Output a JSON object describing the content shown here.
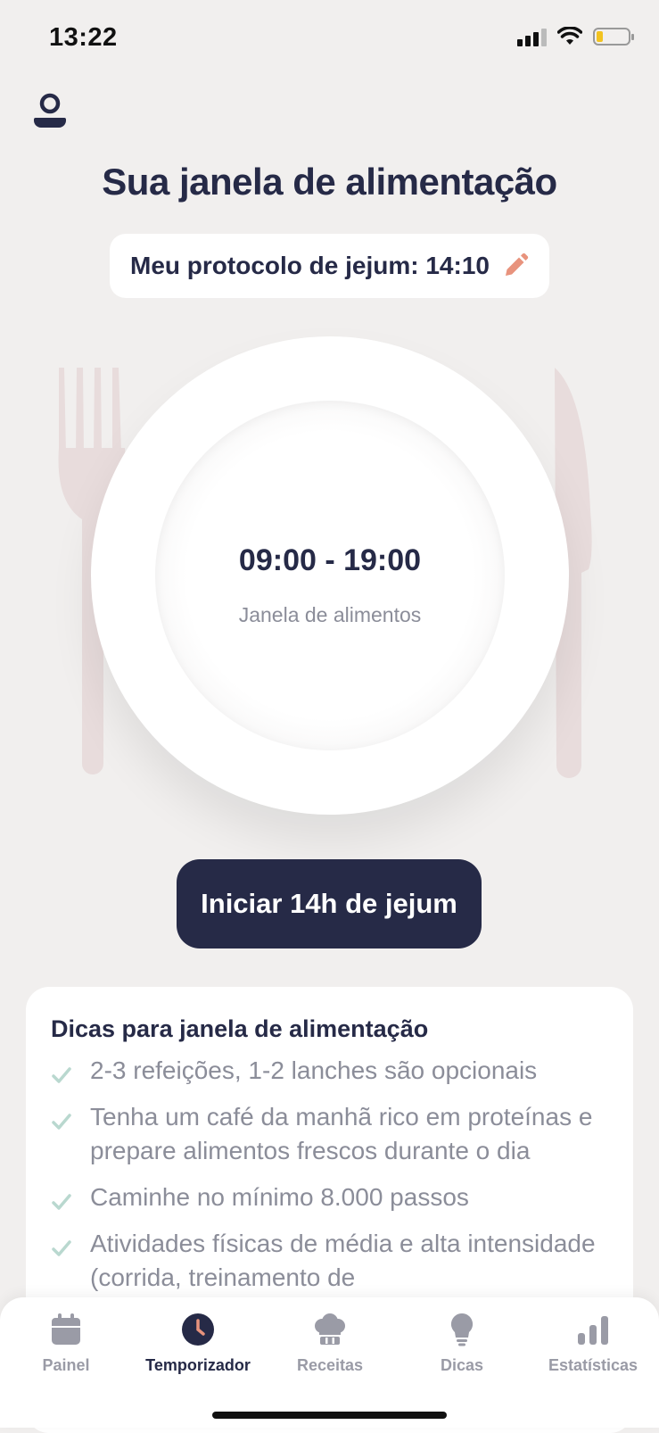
{
  "status": {
    "time": "13:22",
    "signal_icon": "signal-icon",
    "wifi_icon": "wifi-icon",
    "battery_icon": "battery-low-icon",
    "battery_level": 0.2
  },
  "header": {
    "profile_icon": "profile-icon",
    "title": "Sua janela de alimentação"
  },
  "protocol": {
    "label": "Meu protocolo de jejum: 14:10",
    "edit_icon": "pencil-icon"
  },
  "plate": {
    "time_range": "09:00 - 19:00",
    "label": "Janela de alimentos"
  },
  "start_button": {
    "label": "Iniciar 14h de jejum"
  },
  "tips": {
    "title": "Dicas para janela de alimentação",
    "items": [
      "2-3 refeições, 1-2 lanches são opcionais",
      "Tenha um café da manhã rico em proteínas e prepare alimentos frescos durante o dia",
      "Caminhe no mínimo 8.000 passos",
      "Atividades físicas de média e alta intensidade (corrida, treinamento de"
    ]
  },
  "tabs": [
    {
      "label": "Painel",
      "icon": "calendar-icon"
    },
    {
      "label": "Temporizador",
      "icon": "clock-icon",
      "active": true
    },
    {
      "label": "Receitas",
      "icon": "chef-hat-icon"
    },
    {
      "label": "Dicas",
      "icon": "lightbulb-icon"
    },
    {
      "label": "Estatísticas",
      "icon": "bar-chart-icon"
    }
  ],
  "colors": {
    "primary": "#262a47",
    "background": "#f1efee",
    "accent": "#e8937d",
    "check": "#b9d8cf",
    "muted_text": "#8b8d99"
  }
}
